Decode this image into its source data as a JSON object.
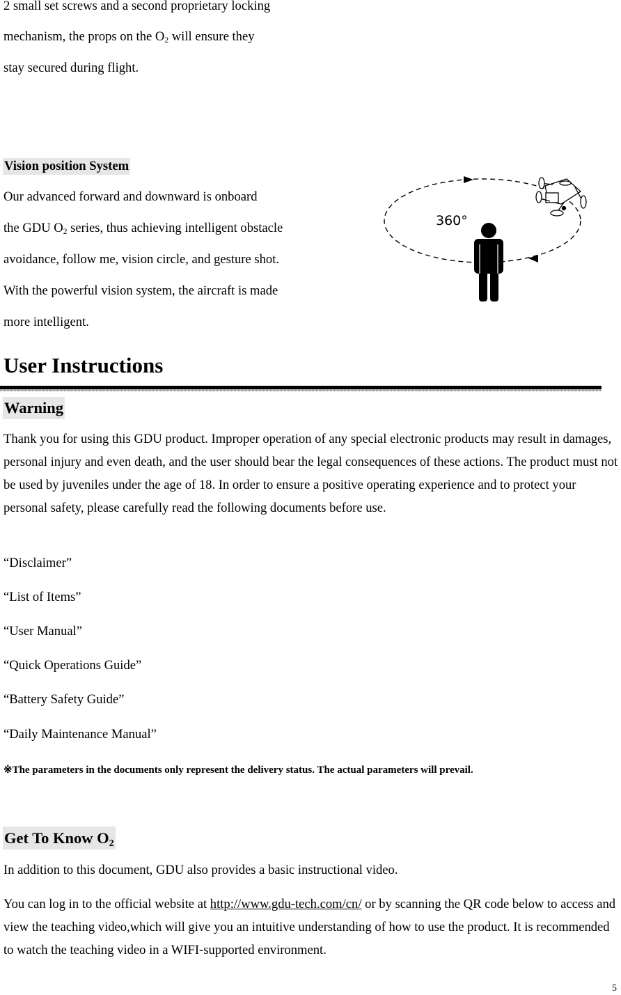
{
  "intro": {
    "lines": [
      "2 small set screws and a second proprietary locking",
      [
        "mechanism, the props on the O",
        "2",
        " will ensure they"
      ],
      "stay secured during flight."
    ]
  },
  "vision": {
    "heading": "Vision position System",
    "line1": "Our advanced forward and downward is onboard",
    "line2_a": "the GDU O",
    "line2_sub": "2",
    "line2_b": " series, thus achieving intelligent obstacle",
    "line3": "avoidance, follow me, vision circle, and gesture shot.",
    "line4": "With the powerful vision system, the aircraft is made",
    "line5": "more intelligent.",
    "diagram": {
      "label": "360°",
      "icons": [
        "orbit-path",
        "person-icon",
        "drone-icon",
        "arrow-icon"
      ]
    }
  },
  "user_instructions": {
    "title": "User Instructions",
    "warning_heading": "Warning",
    "warning_text": "Thank you for using this GDU product. Improper operation of any special electronic products may result in damages, personal injury and even death, and the user should bear the legal consequences of these actions. The product must not be used by juveniles under the age of 18. In order to ensure a positive operating experience and to protect your personal safety, please carefully read the following documents before use.",
    "documents": [
      "“Disclaimer”",
      "“List of Items”",
      "“User Manual”",
      "“Quick Operations Guide”",
      "“Battery Safety Guide”",
      "“Daily Maintenance Manual”"
    ],
    "note": "※The parameters in the documents only represent the delivery status. The actual parameters will prevail."
  },
  "get_to_know": {
    "heading_a": "Get To Know O",
    "heading_sub": "2",
    "para1": "In addition to this document, GDU also provides a basic instructional video.",
    "para2_a": "You can log in to the official website at ",
    "para2_link": "http://www.gdu-tech.com/cn/",
    "para2_b": " or by scanning the QR code below to access and view the teaching video,which will give you an intuitive understanding of how to use the product. It is recommended to watch the teaching video in a WIFI-supported environment."
  },
  "page_number": "5"
}
